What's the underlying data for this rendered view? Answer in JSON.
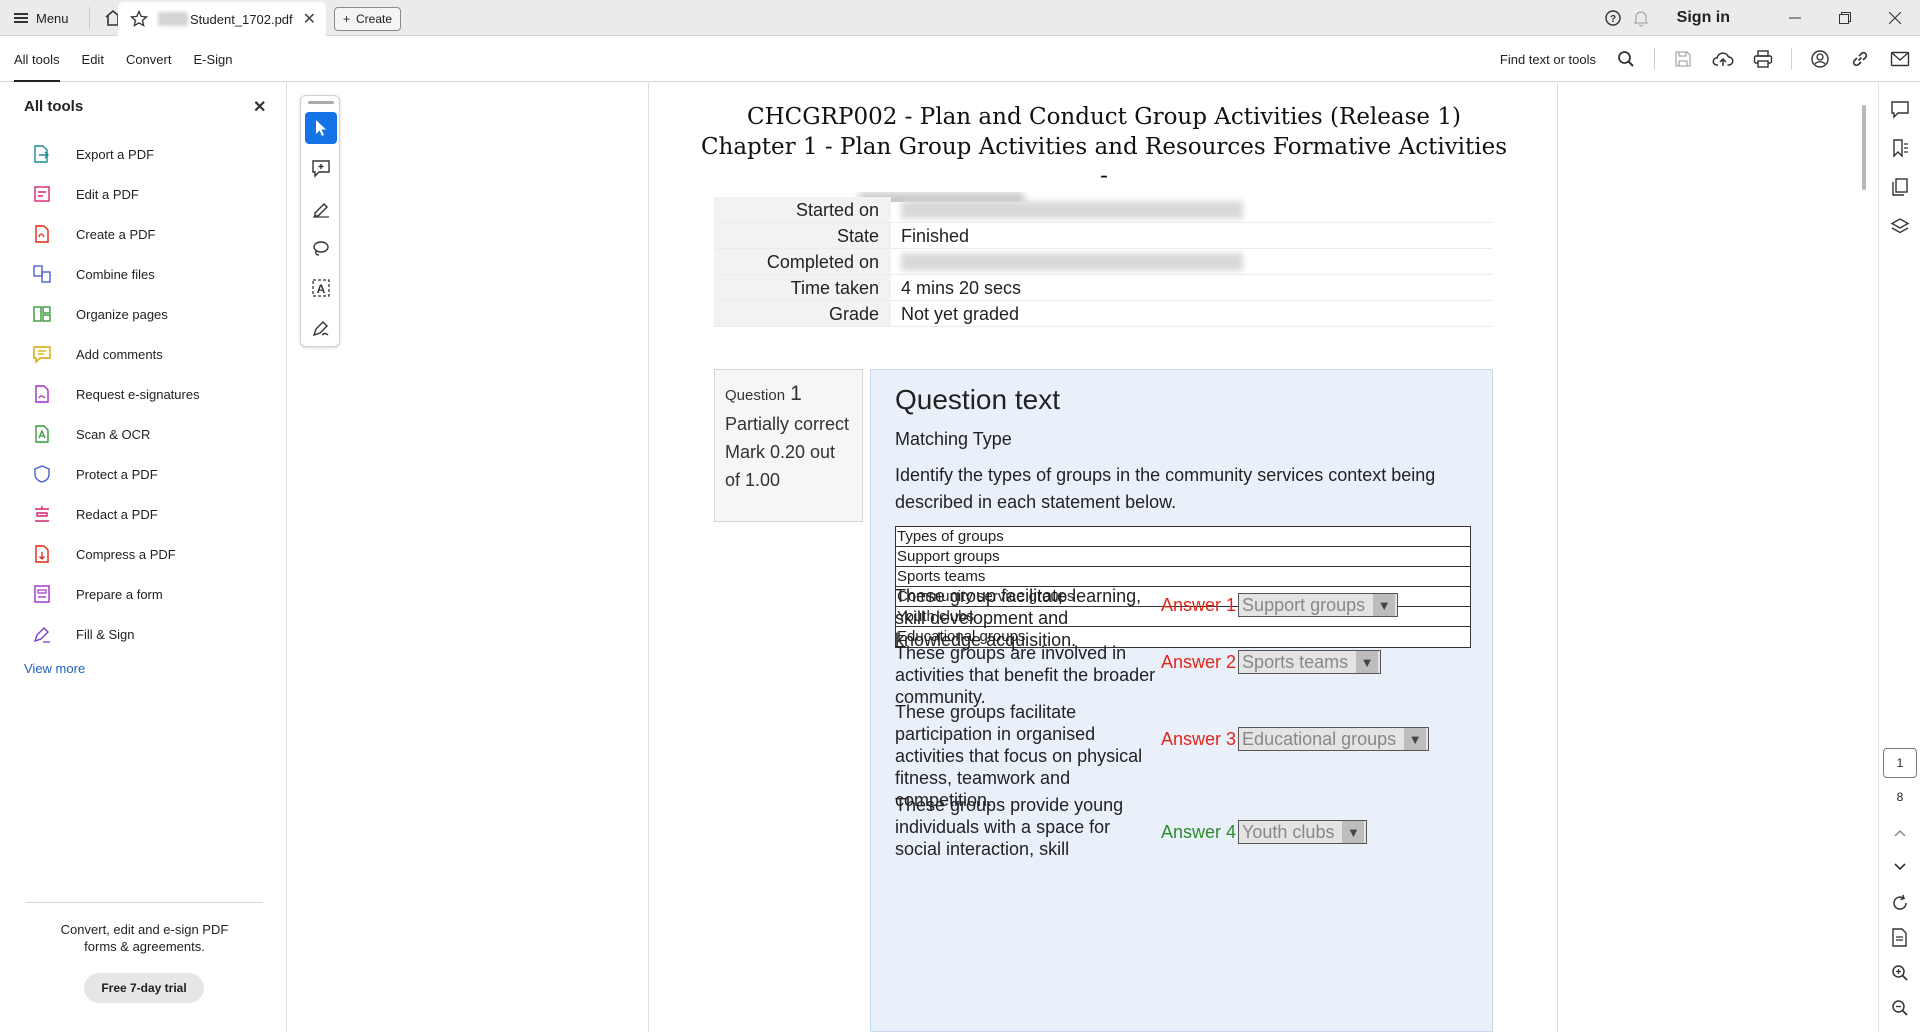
{
  "titlebar": {
    "menu_label": "Menu",
    "tab_filename": "Student_1702.pdf",
    "create_label": "Create",
    "sign_in": "Sign in"
  },
  "toolbar": {
    "tabs": [
      "All tools",
      "Edit",
      "Convert",
      "E-Sign"
    ],
    "find_text": "Find text or tools"
  },
  "left_panel": {
    "title": "All tools",
    "tools": [
      {
        "label": "Export a PDF",
        "icon": "export-pdf-icon",
        "color": "#1a8a9a"
      },
      {
        "label": "Edit a PDF",
        "icon": "edit-pdf-icon",
        "color": "#d6246e"
      },
      {
        "label": "Create a PDF",
        "icon": "create-pdf-icon",
        "color": "#e0261b"
      },
      {
        "label": "Combine files",
        "icon": "combine-files-icon",
        "color": "#4a5ed8"
      },
      {
        "label": "Organize pages",
        "icon": "organize-pages-icon",
        "color": "#3a9a3a"
      },
      {
        "label": "Add comments",
        "icon": "add-comments-icon",
        "color": "#d9a400"
      },
      {
        "label": "Request e-signatures",
        "icon": "request-esignatures-icon",
        "color": "#a02fc8"
      },
      {
        "label": "Scan & OCR",
        "icon": "scan-ocr-icon",
        "color": "#3a9a3a"
      },
      {
        "label": "Protect a PDF",
        "icon": "protect-pdf-icon",
        "color": "#4a5ed8"
      },
      {
        "label": "Redact a PDF",
        "icon": "redact-pdf-icon",
        "color": "#d6246e"
      },
      {
        "label": "Compress a PDF",
        "icon": "compress-pdf-icon",
        "color": "#e0261b"
      },
      {
        "label": "Prepare a form",
        "icon": "prepare-form-icon",
        "color": "#a02fc8"
      },
      {
        "label": "Fill & Sign",
        "icon": "fill-sign-icon",
        "color": "#7a3fd6"
      }
    ],
    "view_more": "View more",
    "promo_line1": "Convert, edit and e-sign PDF",
    "promo_line2": "forms & agreements.",
    "trial_button": "Free 7-day trial"
  },
  "document": {
    "title_line1": "CHCGRP002 - Plan and Conduct Group Activities (Release 1)",
    "title_line2": "Chapter 1 - Plan Group Activities and Resources Formative Activities",
    "title_line3": "-",
    "info": [
      {
        "label": "Started on",
        "value": ""
      },
      {
        "label": "State",
        "value": "Finished"
      },
      {
        "label": "Completed on",
        "value": ""
      },
      {
        "label": "Time taken",
        "value": "4 mins 20 secs"
      },
      {
        "label": "Grade",
        "value": "Not yet graded"
      }
    ],
    "question": {
      "prefix": "Question",
      "number": "1",
      "status": "Partially correct",
      "mark": "Mark 0.20 out of 1.00",
      "heading": "Question text",
      "subheading": "Matching Type",
      "description": "Identify the types of groups in the community services context being described in each statement below.",
      "types": [
        "Types of groups",
        "Support groups",
        "Sports teams",
        "Community service groups",
        "Youth clubs",
        "Educational groups"
      ],
      "answers": [
        {
          "statement": "These group facilitate learning, skill development and knowledge acquisition.",
          "label": "Answer 1",
          "selected": "Support groups",
          "correct": false
        },
        {
          "statement": "These groups are involved in activities that benefit the broader community.",
          "label": "Answer 2",
          "selected": "Sports teams",
          "correct": false
        },
        {
          "statement": "These groups facilitate participation in organised activities that focus on physical fitness, teamwork and competition.",
          "label": "Answer 3",
          "selected": "Educational groups",
          "correct": false
        },
        {
          "statement": "These groups provide young individuals with a space for social interaction, skill",
          "label": "Answer 4",
          "selected": "Youth clubs",
          "correct": true
        }
      ]
    }
  },
  "right_rail": {
    "current_page": "1",
    "total_pages": "8"
  },
  "colors": {
    "accent": "#1473e6",
    "wrong": "#e0261b",
    "right": "#2f8a2f",
    "question_bg": "#e9f0fa"
  }
}
